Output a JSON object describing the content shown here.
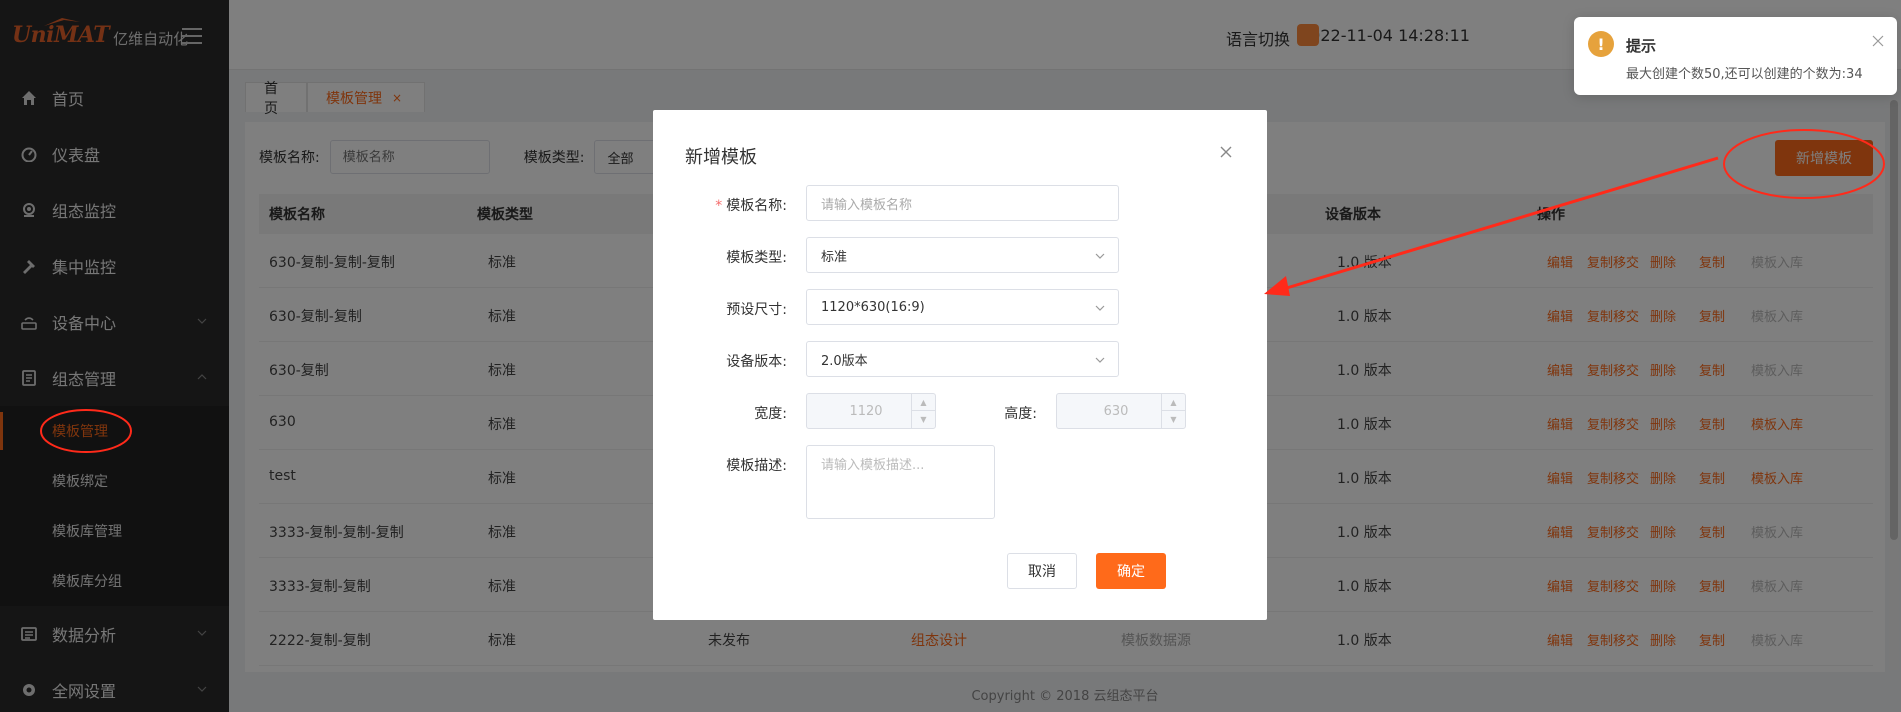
{
  "sidebar": {
    "logo_mark": "UniMAT",
    "logo_text": "亿维自动化",
    "items": [
      {
        "label": "首页",
        "icon": "home-icon"
      },
      {
        "label": "仪表盘",
        "icon": "dashboard-icon"
      },
      {
        "label": "组态监控",
        "icon": "monitor-icon"
      },
      {
        "label": "集中监控",
        "icon": "hammer-icon"
      },
      {
        "label": "设备中心",
        "icon": "router-icon"
      },
      {
        "label": "组态管理",
        "icon": "document-icon"
      },
      {
        "label": "数据分析",
        "icon": "chart-icon"
      },
      {
        "label": "全网设置",
        "icon": "gear-icon"
      }
    ],
    "submenu": [
      {
        "label": "模板管理"
      },
      {
        "label": "模板绑定"
      },
      {
        "label": "模板库管理"
      },
      {
        "label": "模板库分组"
      }
    ]
  },
  "header": {
    "datetime": "2022-11-04 14:28:11",
    "language": "语言切换"
  },
  "tabs": [
    {
      "label": "首页"
    },
    {
      "label": "模板管理",
      "close": "×"
    }
  ],
  "filter": {
    "name_label": "模板名称:",
    "name_placeholder": "模板名称",
    "type_label": "模板类型:",
    "type_value": "全部"
  },
  "add_button": "新增模板",
  "table": {
    "headers": [
      "模板名称",
      "模板类型",
      "设备版本",
      "操作"
    ],
    "rows": [
      {
        "name": "630-复制-复制-复制",
        "type": "标准",
        "version": "1.0 版本",
        "import_enabled": false
      },
      {
        "name": "630-复制-复制",
        "type": "标准",
        "version": "1.0 版本",
        "import_enabled": false
      },
      {
        "name": "630-复制",
        "type": "标准",
        "version": "1.0 版本",
        "import_enabled": false
      },
      {
        "name": "630",
        "type": "标准",
        "version": "1.0 版本",
        "import_enabled": true
      },
      {
        "name": "test",
        "type": "标准",
        "version": "1.0 版本",
        "import_enabled": true
      },
      {
        "name": "3333-复制-复制-复制",
        "type": "标准",
        "version": "1.0 版本",
        "import_enabled": false
      },
      {
        "name": "3333-复制-复制",
        "type": "标准",
        "version": "1.0 版本",
        "import_enabled": false
      },
      {
        "name": "2222-复制-复制",
        "type": "标准",
        "version": "1.0 版本",
        "import_enabled": false,
        "status": "未发布",
        "design": "组态设计",
        "datasource": "模板数据源"
      }
    ],
    "ops": [
      "编辑",
      "复制移交",
      "删除",
      "复制",
      "模板入库"
    ]
  },
  "copyright": "Copyright © 2018 云组态平台",
  "dialog": {
    "title": "新增模板",
    "required_mark": "*",
    "fields": {
      "name_label": "模板名称:",
      "name_placeholder": "请输入模板名称",
      "type_label": "模板类型:",
      "type_value": "标准",
      "size_label": "预设尺寸:",
      "size_value": "1120*630(16:9)",
      "version_label": "设备版本:",
      "version_value": "2.0版本",
      "width_label": "宽度:",
      "width_value": "1120",
      "height_label": "高度:",
      "height_value": "630",
      "desc_label": "模板描述:",
      "desc_placeholder": "请输入模板描述..."
    },
    "cancel": "取消",
    "confirm": "确定"
  },
  "notification": {
    "icon": "!",
    "title": "提示",
    "message": "最大创建个数50,还可以创建的个数为:34"
  },
  "colors": {
    "accent": "#ff6a1a",
    "sidebar": "#2b2b2b",
    "warning": "#e6a23c",
    "annotation": "#ff2a1a"
  }
}
